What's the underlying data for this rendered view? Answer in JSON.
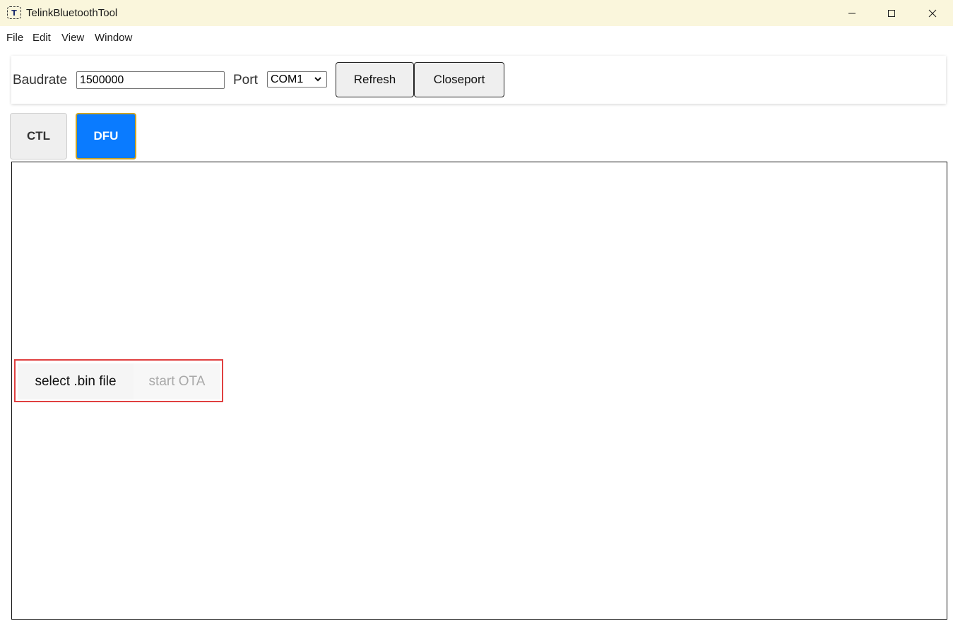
{
  "window": {
    "title": "TelinkBluetoothTool",
    "app_icon_glyph": "T",
    "controls": {
      "minimize": "minimize-icon",
      "maximize": "maximize-icon",
      "close": "close-icon"
    }
  },
  "menu": {
    "items": [
      {
        "label": "File"
      },
      {
        "label": "Edit"
      },
      {
        "label": "View"
      },
      {
        "label": "Window"
      }
    ]
  },
  "toolbar": {
    "baudrate_label": "Baudrate",
    "baudrate_value": "1500000",
    "port_label": "Port",
    "port_value": "COM1",
    "refresh_label": "Refresh",
    "closeport_label": "Closeport"
  },
  "tabs": [
    {
      "label": "CTL",
      "active": false
    },
    {
      "label": "DFU",
      "active": true
    }
  ],
  "dfu": {
    "select_file_label": "select .bin file",
    "start_ota_label": "start OTA",
    "start_ota_enabled": false
  },
  "colors": {
    "titlebar_bg": "#faf6dc",
    "tab_active_bg": "#0a7bff",
    "tab_active_border": "#c9a227",
    "highlight_border": "#e04040",
    "disabled_text": "#a9a9a9"
  }
}
